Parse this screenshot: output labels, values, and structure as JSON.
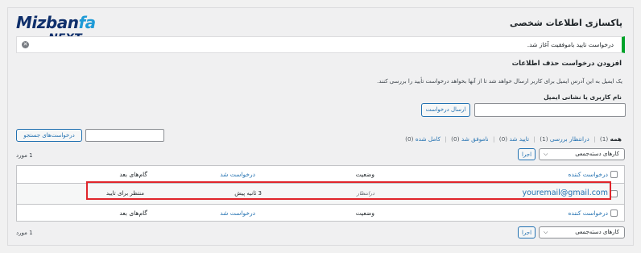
{
  "logo": {
    "main_a": "Mizban",
    "main_b": "fa",
    "sub": "NEXT"
  },
  "page_title": "پاکسازی اطلاعات شخصی",
  "notice": {
    "text": "درخواست تایید باموفقیت آغاز شد.",
    "dismiss": "✕"
  },
  "add_request": {
    "heading": "افزودن درخواست حذف اطلاعات",
    "description": "یک ایمیل به این آدرس ایمیل برای کاربر ارسال خواهد شد تا از آنها بخواهد درخواست تأیید را بررسی کنند.",
    "field_label": "نام کاربری یا نشانی ایمیل",
    "field_value": "",
    "send_button": "ارسال درخواست"
  },
  "filters": {
    "all": "همه",
    "all_count": "(1)",
    "pending": "درانتظار بررسی",
    "pending_count": "(1)",
    "confirmed": "تایید شد",
    "confirmed_count": "(0)",
    "failed": "ناموفق شد",
    "failed_count": "(0)",
    "completed": "کامل شده",
    "completed_count": "(0)",
    "separator": "|"
  },
  "search": {
    "value": "",
    "button": "درخواست‌های جستجو"
  },
  "bulk": {
    "select_label": "کارهای دسته‌جمعی",
    "apply": "اجرا"
  },
  "items_count": "1 مورد",
  "table": {
    "columns": {
      "requester": "درخواست کننده",
      "status": "وضعیت",
      "requested": "درخواست شد",
      "next_steps": "گام‌های بعد"
    },
    "rows": [
      {
        "requester": "youremail@gmail.com",
        "status": "درانتظار",
        "requested": "3 ثانیه پیش",
        "next_steps": "منتظر برای تایید"
      }
    ]
  },
  "colors": {
    "accent": "#2271b1",
    "success": "#00a32a",
    "highlight": "#e0252b"
  }
}
